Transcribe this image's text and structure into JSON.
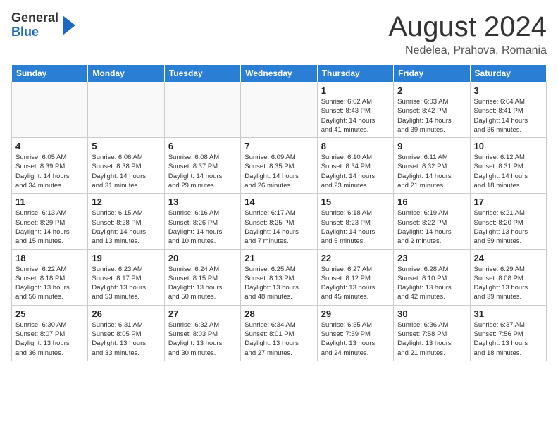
{
  "header": {
    "logo_line1": "General",
    "logo_line2": "Blue",
    "month_title": "August 2024",
    "location": "Nedelea, Prahova, Romania"
  },
  "weekdays": [
    "Sunday",
    "Monday",
    "Tuesday",
    "Wednesday",
    "Thursday",
    "Friday",
    "Saturday"
  ],
  "weeks": [
    [
      {
        "day": "",
        "info": ""
      },
      {
        "day": "",
        "info": ""
      },
      {
        "day": "",
        "info": ""
      },
      {
        "day": "",
        "info": ""
      },
      {
        "day": "1",
        "info": "Sunrise: 6:02 AM\nSunset: 8:43 PM\nDaylight: 14 hours\nand 41 minutes."
      },
      {
        "day": "2",
        "info": "Sunrise: 6:03 AM\nSunset: 8:42 PM\nDaylight: 14 hours\nand 39 minutes."
      },
      {
        "day": "3",
        "info": "Sunrise: 6:04 AM\nSunset: 8:41 PM\nDaylight: 14 hours\nand 36 minutes."
      }
    ],
    [
      {
        "day": "4",
        "info": "Sunrise: 6:05 AM\nSunset: 8:39 PM\nDaylight: 14 hours\nand 34 minutes."
      },
      {
        "day": "5",
        "info": "Sunrise: 6:06 AM\nSunset: 8:38 PM\nDaylight: 14 hours\nand 31 minutes."
      },
      {
        "day": "6",
        "info": "Sunrise: 6:08 AM\nSunset: 8:37 PM\nDaylight: 14 hours\nand 29 minutes."
      },
      {
        "day": "7",
        "info": "Sunrise: 6:09 AM\nSunset: 8:35 PM\nDaylight: 14 hours\nand 26 minutes."
      },
      {
        "day": "8",
        "info": "Sunrise: 6:10 AM\nSunset: 8:34 PM\nDaylight: 14 hours\nand 23 minutes."
      },
      {
        "day": "9",
        "info": "Sunrise: 6:11 AM\nSunset: 8:32 PM\nDaylight: 14 hours\nand 21 minutes."
      },
      {
        "day": "10",
        "info": "Sunrise: 6:12 AM\nSunset: 8:31 PM\nDaylight: 14 hours\nand 18 minutes."
      }
    ],
    [
      {
        "day": "11",
        "info": "Sunrise: 6:13 AM\nSunset: 8:29 PM\nDaylight: 14 hours\nand 15 minutes."
      },
      {
        "day": "12",
        "info": "Sunrise: 6:15 AM\nSunset: 8:28 PM\nDaylight: 14 hours\nand 13 minutes."
      },
      {
        "day": "13",
        "info": "Sunrise: 6:16 AM\nSunset: 8:26 PM\nDaylight: 14 hours\nand 10 minutes."
      },
      {
        "day": "14",
        "info": "Sunrise: 6:17 AM\nSunset: 8:25 PM\nDaylight: 14 hours\nand 7 minutes."
      },
      {
        "day": "15",
        "info": "Sunrise: 6:18 AM\nSunset: 8:23 PM\nDaylight: 14 hours\nand 5 minutes."
      },
      {
        "day": "16",
        "info": "Sunrise: 6:19 AM\nSunset: 8:22 PM\nDaylight: 14 hours\nand 2 minutes."
      },
      {
        "day": "17",
        "info": "Sunrise: 6:21 AM\nSunset: 8:20 PM\nDaylight: 13 hours\nand 59 minutes."
      }
    ],
    [
      {
        "day": "18",
        "info": "Sunrise: 6:22 AM\nSunset: 8:18 PM\nDaylight: 13 hours\nand 56 minutes."
      },
      {
        "day": "19",
        "info": "Sunrise: 6:23 AM\nSunset: 8:17 PM\nDaylight: 13 hours\nand 53 minutes."
      },
      {
        "day": "20",
        "info": "Sunrise: 6:24 AM\nSunset: 8:15 PM\nDaylight: 13 hours\nand 50 minutes."
      },
      {
        "day": "21",
        "info": "Sunrise: 6:25 AM\nSunset: 8:13 PM\nDaylight: 13 hours\nand 48 minutes."
      },
      {
        "day": "22",
        "info": "Sunrise: 6:27 AM\nSunset: 8:12 PM\nDaylight: 13 hours\nand 45 minutes."
      },
      {
        "day": "23",
        "info": "Sunrise: 6:28 AM\nSunset: 8:10 PM\nDaylight: 13 hours\nand 42 minutes."
      },
      {
        "day": "24",
        "info": "Sunrise: 6:29 AM\nSunset: 8:08 PM\nDaylight: 13 hours\nand 39 minutes."
      }
    ],
    [
      {
        "day": "25",
        "info": "Sunrise: 6:30 AM\nSunset: 8:07 PM\nDaylight: 13 hours\nand 36 minutes."
      },
      {
        "day": "26",
        "info": "Sunrise: 6:31 AM\nSunset: 8:05 PM\nDaylight: 13 hours\nand 33 minutes."
      },
      {
        "day": "27",
        "info": "Sunrise: 6:32 AM\nSunset: 8:03 PM\nDaylight: 13 hours\nand 30 minutes."
      },
      {
        "day": "28",
        "info": "Sunrise: 6:34 AM\nSunset: 8:01 PM\nDaylight: 13 hours\nand 27 minutes."
      },
      {
        "day": "29",
        "info": "Sunrise: 6:35 AM\nSunset: 7:59 PM\nDaylight: 13 hours\nand 24 minutes."
      },
      {
        "day": "30",
        "info": "Sunrise: 6:36 AM\nSunset: 7:58 PM\nDaylight: 13 hours\nand 21 minutes."
      },
      {
        "day": "31",
        "info": "Sunrise: 6:37 AM\nSunset: 7:56 PM\nDaylight: 13 hours\nand 18 minutes."
      }
    ]
  ]
}
